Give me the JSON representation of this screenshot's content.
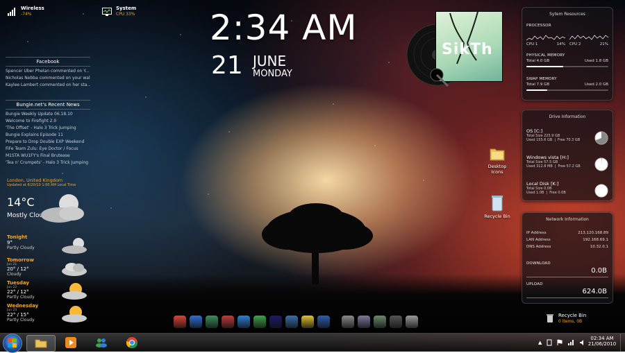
{
  "top_left": {
    "wireless": {
      "title": "Wireless",
      "value": "-74%"
    },
    "system": {
      "title": "System",
      "value": "CPU 33%"
    }
  },
  "clock": {
    "time": "2:34 AM",
    "day": "21",
    "month": "JUNE",
    "weekday": "MONDAY"
  },
  "album": {
    "title": "SikTh"
  },
  "facebook": {
    "title": "Facebook",
    "items": [
      "Spencer Uber Phelan commented on Y...",
      "Nicholas Nebba commented on your wal...",
      "Kaylee Lambert commented on her sta..."
    ]
  },
  "bungie": {
    "title": "Bungie.net's Recent News",
    "items": [
      "Bungie Weekly Update 06.18.10",
      "Welcome to Firefight 2.0",
      "'The Offset' - Halo 3 Trick Jumping",
      "Bungie Explains Episode 11",
      "Prepare to Drop Double EXP Weekend",
      "FiFe Team Zulu: Eye Doctor / Focus",
      "M1STA WU1FY's Final Brutease",
      "'Tea n' Crumpets' - Halo 3 Trick Jumping"
    ]
  },
  "weather": {
    "location": "London, United Kingdom",
    "updated": "Updated at 6/20/10 1:00 AM Local Time",
    "temp": "14°C",
    "condition": "Mostly Cloudy",
    "forecast": [
      {
        "day": "Tonight",
        "sub": "",
        "temp": "9°",
        "cond": "Partly Cloudy",
        "icon": "moon-cloud-icon"
      },
      {
        "day": "Tomorrow",
        "sub": "Jun 21",
        "temp": "20° / 12°",
        "cond": "Cloudy",
        "icon": "cloud-icon"
      },
      {
        "day": "Tuesday",
        "sub": "Jun 22",
        "temp": "22° / 12°",
        "cond": "Partly Cloudy",
        "icon": "sun-cloud-icon"
      },
      {
        "day": "Wednesday",
        "sub": "Jun 23",
        "temp": "22° / 15°",
        "cond": "Partly Cloudy",
        "icon": "sun-cloud-icon"
      }
    ]
  },
  "sysres": {
    "title": "Sytem Resources",
    "processor_label": "PROCESSOR",
    "cpu1": {
      "label": "CPU 1",
      "value": "14%"
    },
    "cpu2": {
      "label": "CPU 2",
      "value": "21%"
    },
    "physical": {
      "label": "PHYSICAL MEMORY",
      "total": "Total 4.0 GB",
      "used": "Used 1.8 GB",
      "fraction": 0.45
    },
    "swap": {
      "label": "SWAP MEMORY",
      "total": "Total 7.9 GB",
      "used": "Used 2.0 GB",
      "fraction": 0.25
    }
  },
  "drives": {
    "title": "Drive Information",
    "items": [
      {
        "name": "OS [C:]",
        "total": "Total Size  225.9 GB",
        "used": "Used 155.6 GB",
        "free": "Free 70.3 GB",
        "fraction": 0.69
      },
      {
        "name": "Windows vista [H:]",
        "total": "Total Size  57.5 GB",
        "used": "Used 312.8 MB",
        "free": "Free 57.2 GB",
        "fraction": 0.01
      },
      {
        "name": "Local Disk [K:]",
        "total": "Total Size  0.0B",
        "used": "Used 1.0B",
        "free": "Free 0.0B",
        "fraction": 0.0
      }
    ]
  },
  "network": {
    "title": "Network Information",
    "ip_label": "IP Address",
    "ip": "213.120.168.89",
    "lan_label": "LAN Address",
    "lan": "192.168.69.1",
    "dns_label": "DNS Address",
    "dns": "10.32.0.1",
    "download_label": "DOWNLOAD",
    "download": "0.0B",
    "upload_label": "UPLOAD",
    "upload": "624.0B"
  },
  "desktop_icons": {
    "desktop": "Desktop Icons",
    "recycle": "Recycle Bin"
  },
  "recycle_gadget": {
    "title": "Recycle Bin",
    "items": "0 items, 0B"
  },
  "dock": {
    "icons": [
      "chrome-icon",
      "bird-icon",
      "pen-icon",
      "network-icon",
      "browser-icon",
      "people-icon",
      "playstation-icon",
      "water-icon",
      "puzzle-icon",
      "notes-icon",
      "folder-icon",
      "folder-music-icon",
      "folder-pictures-icon",
      "games-icon",
      "folder-docs-icon"
    ]
  },
  "taskbar": {
    "time": "02:34 AM",
    "date": "21/06/2010"
  },
  "colors": {
    "accent_orange": "#f5a623",
    "cpu_green": "#7cd36b"
  }
}
